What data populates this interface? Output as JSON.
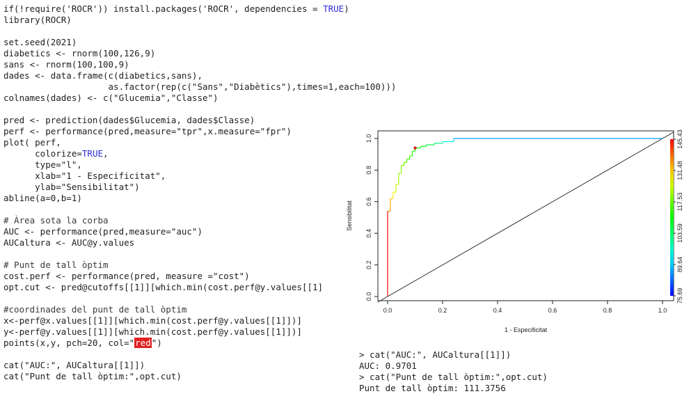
{
  "code_lines": [
    "if(!require('ROCR')) install.packages('ROCR', dependencies = TRUE)",
    "library(ROCR)",
    "",
    "set.seed(2021)",
    "diabetics <- rnorm(100,126,9)",
    "sans <- rnorm(100,100,9)",
    "dades <- data.frame(c(diabetics,sans),",
    "                    as.factor(rep(c(\"Sans\",\"Diabètics\"),times=1,each=100)))",
    "colnames(dades) <- c(\"Glucemia\",\"Classe\")",
    "",
    "pred <- prediction(dades$Glucemia, dades$Classe)",
    "perf <- performance(pred,measure=\"tpr\",x.measure=\"fpr\")",
    "plot( perf,",
    "      colorize=TRUE,",
    "      type=\"l\",",
    "      xlab=\"1 - Especificitat\",",
    "      ylab=\"Sensibilitat\")",
    "abline(a=0,b=1)",
    "",
    "# Àrea sota la corba",
    "AUC <- performance(pred,measure=\"auc\")",
    "AUCaltura <- AUC@y.values",
    "",
    "# Punt de tall òptim",
    "cost.perf <- performance(pred, measure =\"cost\")",
    "opt.cut <- pred@cutoffs[[1]][which.min(cost.perf@y.values[[1]",
    "",
    "#coordinades del punt de tall òptim",
    "x<-perf@x.values[[1]][which.min(cost.perf@y.values[[1]])]",
    "y<-perf@y.values[[1]][which.min(cost.perf@y.values[[1]])]",
    "points(x,y, pch=20, col=\"red\")",
    "",
    "cat(\"AUC:\", AUCaltura[[1]])",
    "cat(\"Punt de tall òptim:\",opt.cut)"
  ],
  "console_lines": [
    "> cat(\"AUC:\", AUCaltura[[1]])",
    "AUC: 0.9701",
    "> cat(\"Punt de tall òptim:\",opt.cut)",
    "Punt de tall òptim: 111.3756"
  ],
  "chart_data": {
    "type": "line",
    "xlabel": "1 - Especificitat",
    "ylabel": "Sensibilitat",
    "xlim": [
      0,
      1.0
    ],
    "ylim": [
      0,
      1.0
    ],
    "x_ticks": [
      "0.0",
      "0.2",
      "0.4",
      "0.6",
      "0.8",
      "1.0"
    ],
    "y_ticks": [
      "0.0",
      "0.2",
      "0.4",
      "0.6",
      "0.8",
      "1.0"
    ],
    "series": [
      {
        "x": [
          0,
          0,
          0.01,
          0.01,
          0.02,
          0.02,
          0.03,
          0.03,
          0.04,
          0.04,
          0.05,
          0.05,
          0.06,
          0.06,
          0.07,
          0.07,
          0.08,
          0.08,
          0.09,
          0.09,
          0.1,
          0.1,
          0.12,
          0.12,
          0.14,
          0.14,
          0.17,
          0.17,
          0.2,
          0.2,
          0.24,
          0.24,
          1.0
        ],
        "y": [
          0,
          0.54,
          0.54,
          0.62,
          0.62,
          0.66,
          0.66,
          0.71,
          0.71,
          0.78,
          0.78,
          0.83,
          0.83,
          0.85,
          0.85,
          0.87,
          0.87,
          0.89,
          0.89,
          0.92,
          0.92,
          0.94,
          0.94,
          0.95,
          0.95,
          0.96,
          0.96,
          0.97,
          0.97,
          0.98,
          0.98,
          1.0,
          1.0
        ],
        "cutoff": [
          145.43,
          138,
          134,
          131,
          129,
          127,
          125,
          123,
          122,
          121,
          120,
          119,
          118,
          117,
          116,
          115,
          114,
          113.5,
          113,
          112,
          111.5,
          111,
          110,
          109,
          108,
          106,
          104,
          101,
          98,
          95,
          91,
          87,
          75.69
        ]
      }
    ],
    "abline": {
      "a": 0,
      "b": 1
    },
    "optimal_point": {
      "x": 0.1,
      "y": 0.94,
      "color": "#e02020"
    },
    "colorbar": {
      "ticks": [
        "75.69",
        "89.64",
        "103.59",
        "117.53",
        "131.48",
        "145.43"
      ],
      "min": 75.69,
      "max": 145.43
    },
    "grid": false
  }
}
